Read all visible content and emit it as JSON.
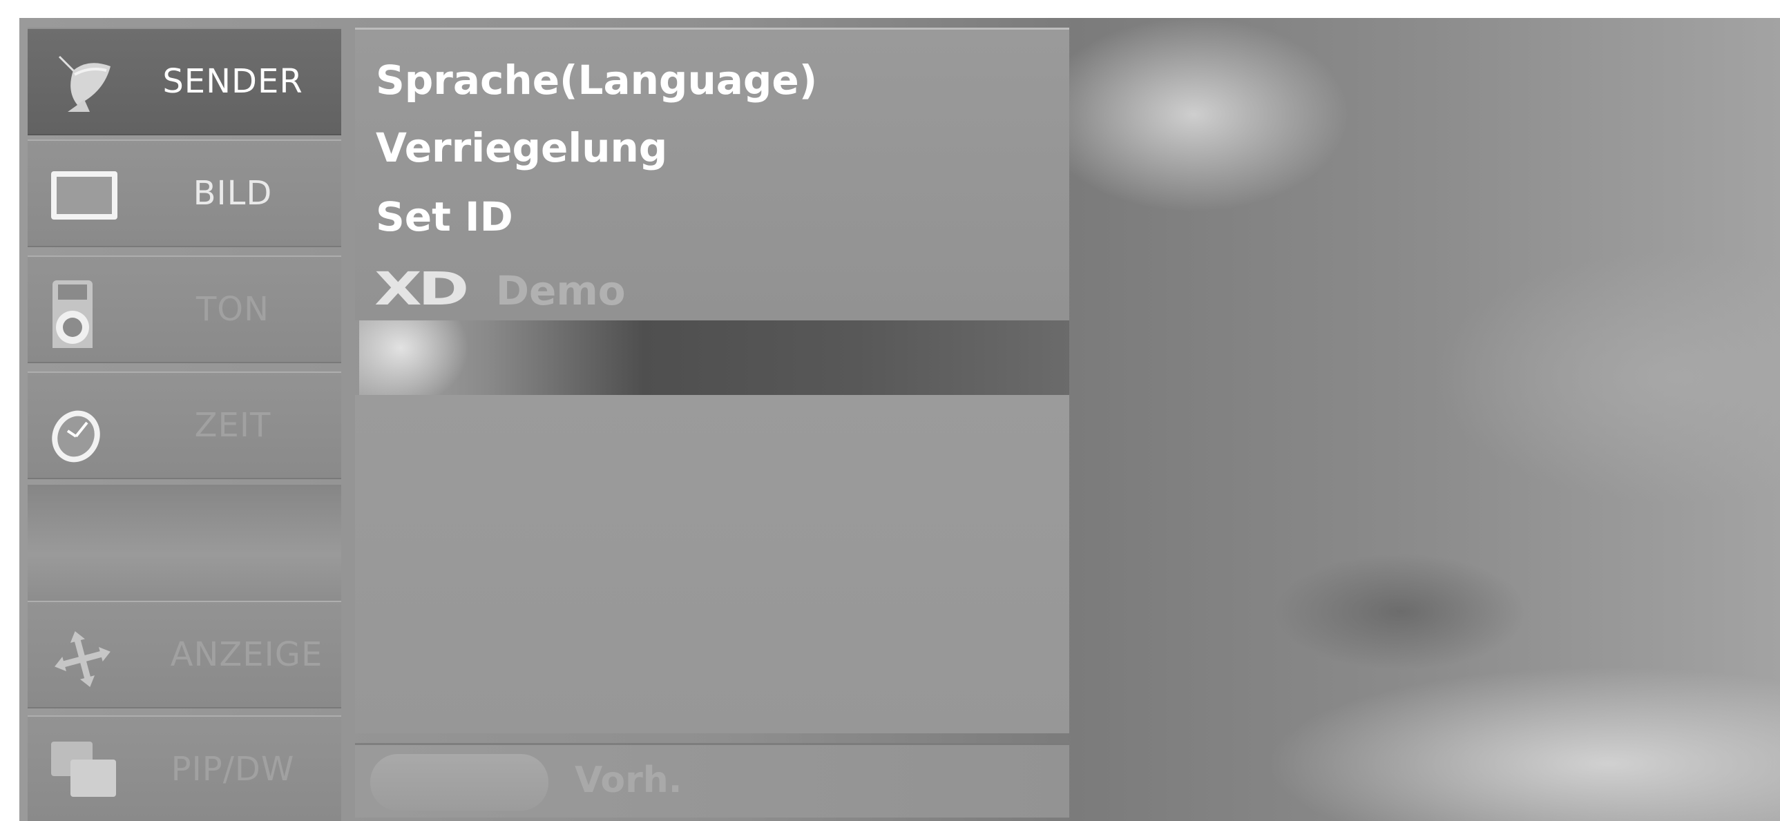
{
  "sidebar": {
    "items": [
      {
        "label": "SENDER",
        "icon": "satellite-dish-icon",
        "state": "active"
      },
      {
        "label": "BILD",
        "icon": "tv-screen-icon",
        "state": "normal"
      },
      {
        "label": "TON",
        "icon": "speaker-icon",
        "state": "dim"
      },
      {
        "label": "ZEIT",
        "icon": "clock-icon",
        "state": "dim"
      },
      {
        "label": "ANZEIGE",
        "icon": "move-arrows-icon",
        "state": "dim"
      },
      {
        "label": "PIP/DW",
        "icon": "pip-windows-icon",
        "state": "dim"
      }
    ]
  },
  "menu": {
    "items": [
      {
        "label": "Sprache(Language)",
        "state": "enabled"
      },
      {
        "label": "Verriegelung",
        "state": "enabled"
      },
      {
        "label": "Set ID",
        "state": "enabled"
      },
      {
        "label": "Demo",
        "state": "disabled",
        "badge": "XD"
      }
    ]
  },
  "footer": {
    "label": "Vorh."
  },
  "colors": {
    "active_bg": "#666666",
    "panel_bg": "#979797",
    "text_active": "#ffffff",
    "text_disabled": "#b1b1b1"
  }
}
